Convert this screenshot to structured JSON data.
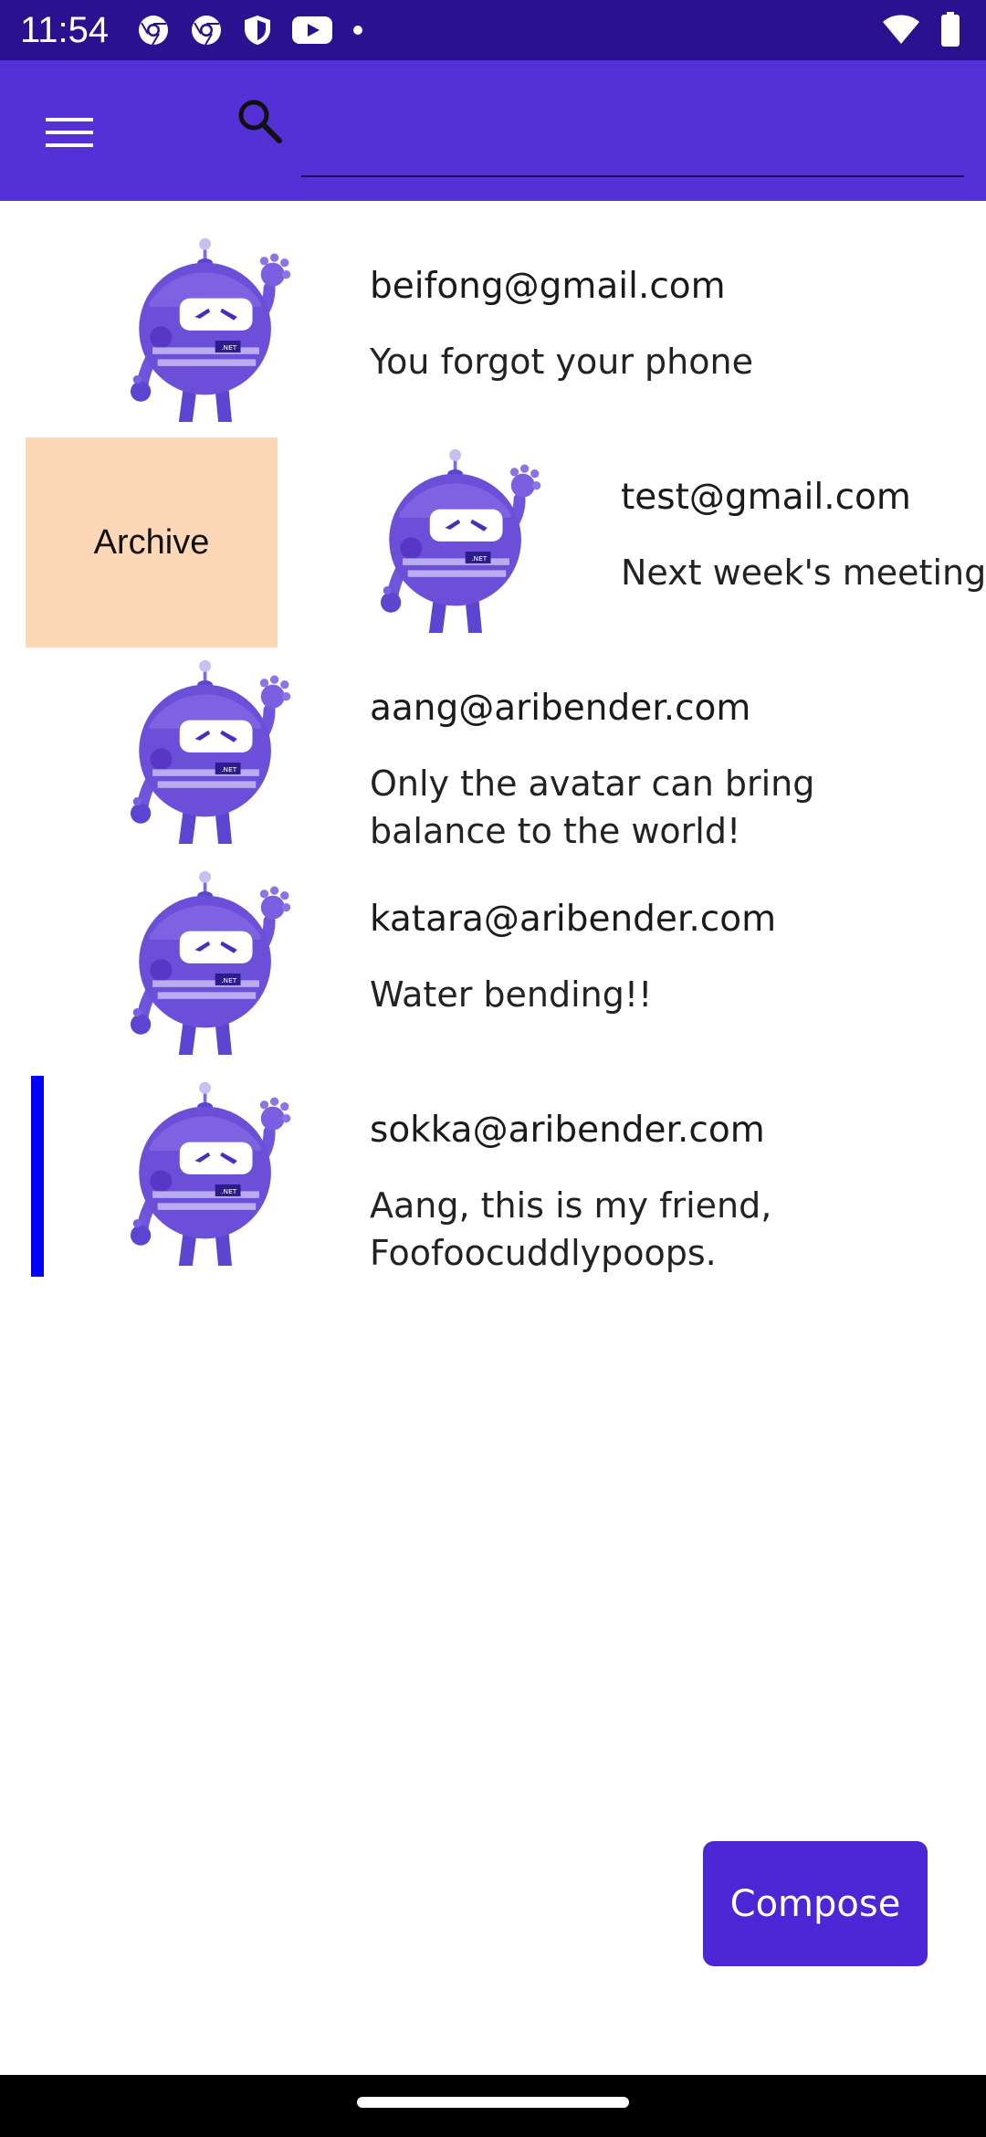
{
  "status_bar": {
    "time": "11:54",
    "left_icons": [
      "chrome-icon",
      "chrome-icon",
      "shield-icon",
      "youtube-icon",
      "notification-dot-icon"
    ],
    "right_icons": [
      "wifi-icon",
      "battery-icon"
    ]
  },
  "app_bar": {
    "menu_icon": "hamburger-menu-icon",
    "search_icon": "search-icon",
    "search_value": "",
    "search_placeholder": ""
  },
  "emails": [
    {
      "sender": "beifong@gmail.com",
      "subject": "You forgot your phone",
      "avatar_icon": "dotnet-bot-avatar-icon"
    },
    {
      "sender": "test@gmail.com",
      "subject": "Next week's meeting",
      "avatar_icon": "dotnet-bot-avatar-icon"
    },
    {
      "sender": "aang@aribender.com",
      "subject": "Only the avatar can bring balance to the world!",
      "avatar_icon": "dotnet-bot-avatar-icon"
    },
    {
      "sender": "katara@aribender.com",
      "subject": "Water bending!!",
      "avatar_icon": "dotnet-bot-avatar-icon"
    },
    {
      "sender": "sokka@aribender.com",
      "subject": "Aang, this is my friend, Foofoocuddlypoops.",
      "avatar_icon": "dotnet-bot-avatar-icon"
    }
  ],
  "swipe_action": {
    "label": "Archive",
    "color": "#fcd8b8"
  },
  "selection_indicator_color": "#0000ff",
  "compose_button": {
    "label": "Compose"
  },
  "colors": {
    "status_bar": "#2a118f",
    "app_bar": "#5331d6",
    "compose": "#4c25d5"
  }
}
